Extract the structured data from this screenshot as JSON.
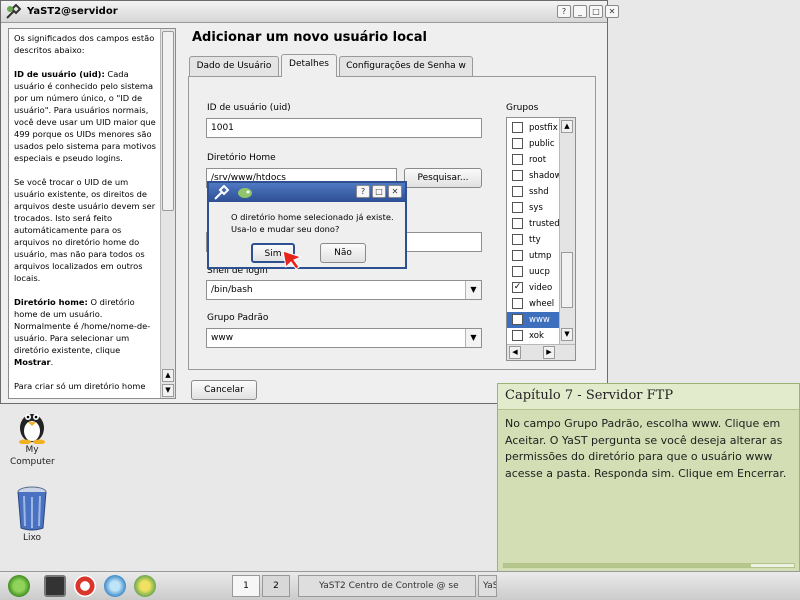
{
  "window": {
    "title": "YaST2@servidor",
    "heading": "Adicionar um novo usuário local",
    "tabs": [
      "Dado de Usuário",
      "Detalhes",
      "Configurações de Senha w"
    ],
    "active_tab": "Detalhes"
  },
  "help": {
    "p1": "Os significados dos campos estão descritos abaixo:",
    "p2_bold": "ID de usuário (uid):",
    "p2": " Cada usuário é conhecido pelo sistema por um número único, o \"ID de usuário\". Para usuários normais, você deve usar um UID maior que 499 porque os UIDs menores são usados pelo sistema para motivos especiais e pseudo logins.",
    "p3": "Se você trocar o UID de um usuário existente, os direitos de arquivos deste usuário devem ser trocados. Isto será feito automáticamente para os arquivos no diretório home do usuário, mas não para todos os arquivos localizados em outros locais.",
    "p4_bold": "Diretório home:",
    "p4": " O diretório home de um usuário. Normalmente é /home/nome-de-usuário. Para selecionar um diretório existente, clique ",
    "p4_end_bold": "Mostrar",
    "p4_end": ".",
    "p5": "Para criar só um diretório home"
  },
  "form": {
    "uid_label": "ID de usuário (uid)",
    "uid_value": "1001",
    "home_label": "Diretório Home",
    "home_value": "/srv/www/htdocs",
    "browse_label": "Pesquisar...",
    "shell_label": "Shell de login",
    "shell_value": "/bin/bash",
    "group_label": "Grupo Padrão",
    "group_value": "www",
    "cancel_label": "Cancelar"
  },
  "groups": {
    "label": "Grupos",
    "items": [
      {
        "name": "postfix",
        "checked": false
      },
      {
        "name": "public",
        "checked": false
      },
      {
        "name": "root",
        "checked": false
      },
      {
        "name": "shadow",
        "checked": false
      },
      {
        "name": "sshd",
        "checked": false
      },
      {
        "name": "sys",
        "checked": false
      },
      {
        "name": "trusted",
        "checked": false
      },
      {
        "name": "tty",
        "checked": false
      },
      {
        "name": "utmp",
        "checked": false
      },
      {
        "name": "uucp",
        "checked": false
      },
      {
        "name": "video",
        "checked": true
      },
      {
        "name": "wheel",
        "checked": false
      },
      {
        "name": "www",
        "checked": true,
        "selected": true
      },
      {
        "name": "xok",
        "checked": false
      }
    ]
  },
  "dialog": {
    "message": "O diretório home selecionado já existe. Usa-lo e mudar seu dono?",
    "yes_label": "Sim",
    "no_label": "Não"
  },
  "desktop": {
    "icons": [
      {
        "label": "My Computer"
      },
      {
        "label": "Lixo"
      }
    ]
  },
  "taskbar": {
    "pagers": [
      "1",
      "2"
    ],
    "tasks": [
      "YaST2 Centro de Controle @ se",
      "YaS"
    ]
  },
  "tutorial": {
    "title": "Capítulo 7 - Servidor FTP",
    "text": "No campo Grupo Padrão, escolha www. Clique em Aceitar. O YaST pergunta se você deseja alterar as permissões do diretório para que o usuário www acesse a pasta. Responda sim. Clique em Encerrar.",
    "progress": 0.85
  },
  "colors": {
    "accent": "#3d6fbd",
    "dialog_border": "#2c5090",
    "tutorial_bg": "#d3deb4"
  }
}
